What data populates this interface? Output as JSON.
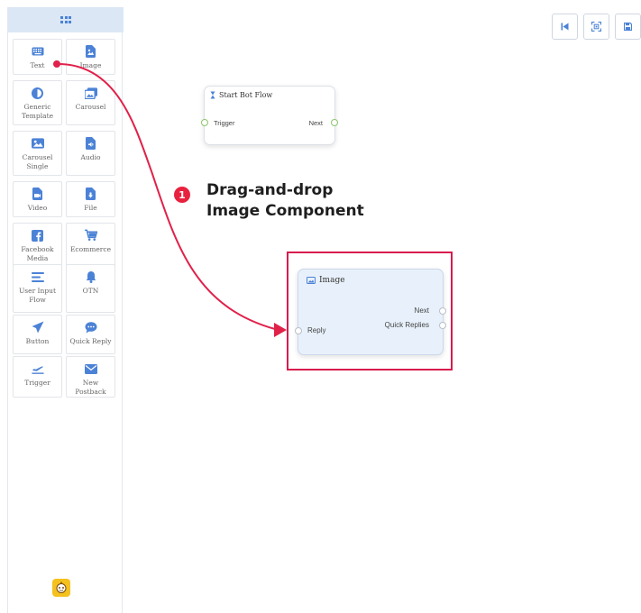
{
  "sidebar": {
    "components": [
      {
        "label": "Text",
        "icon": "keyboard-icon"
      },
      {
        "label": "Image",
        "icon": "image-file-icon"
      },
      {
        "label": "Generic Template",
        "icon": "half-circle-icon"
      },
      {
        "label": "Carousel",
        "icon": "images-icon"
      },
      {
        "label": "Carousel Single",
        "icon": "picture-icon"
      },
      {
        "label": "Audio",
        "icon": "audio-file-icon"
      },
      {
        "label": "Video",
        "icon": "video-file-icon"
      },
      {
        "label": "File",
        "icon": "download-file-icon"
      },
      {
        "label": "Facebook Media",
        "icon": "facebook-icon"
      },
      {
        "label": "Ecommerce",
        "icon": "cart-icon"
      },
      {
        "label": "User Input Flow",
        "icon": "lines-icon"
      },
      {
        "label": "OTN",
        "icon": "bell-icon"
      },
      {
        "label": "Button",
        "icon": "send-icon"
      },
      {
        "label": "Quick Reply",
        "icon": "chat-bubble-icon"
      },
      {
        "label": "Trigger",
        "icon": "plane-icon"
      },
      {
        "label": "New Postback",
        "icon": "envelope-icon"
      }
    ]
  },
  "toolbar": {
    "buttons": [
      {
        "icon": "skip-back-icon"
      },
      {
        "icon": "fit-screen-icon"
      },
      {
        "icon": "save-icon"
      }
    ]
  },
  "start_node": {
    "title": "Start Bot Flow",
    "input_label": "Trigger",
    "output_label": "Next"
  },
  "image_node": {
    "title": "Image",
    "input_label": "Reply",
    "outputs": [
      "Next",
      "Quick Replies"
    ]
  },
  "callout": {
    "number": "1",
    "line1": "Drag-and-drop",
    "line2": "Image Component"
  },
  "colors": {
    "accent": "#4b82d6",
    "annotation": "#d81b4f",
    "port": "#8bc56b"
  }
}
